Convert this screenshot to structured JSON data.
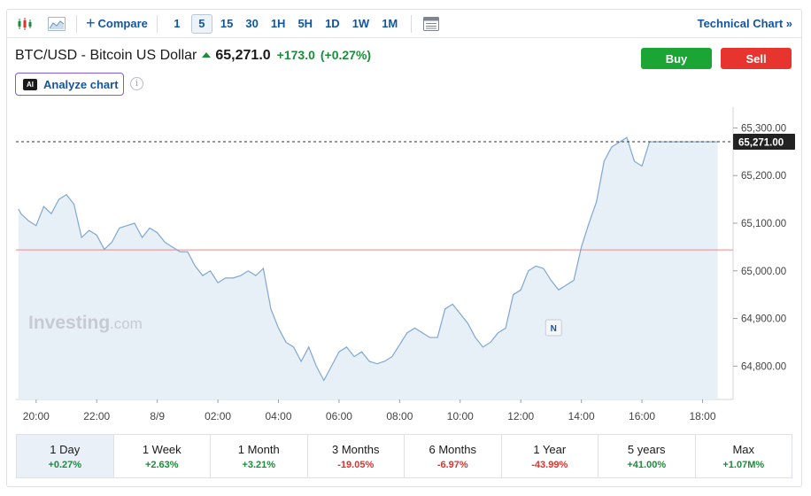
{
  "toolbar": {
    "icons": [
      "candlestick-icon",
      "area-chart-icon"
    ],
    "compare_label": "Compare",
    "intervals": [
      "1",
      "5",
      "15",
      "30",
      "1H",
      "5H",
      "1D",
      "1W",
      "1M"
    ],
    "active_interval": "5",
    "technical_chart_label": "Technical Chart »"
  },
  "header": {
    "symbol": "BTC/USD - Bitcoin US Dollar",
    "price": "65,271.0",
    "change": "+173.0",
    "change_pct": "(+0.27%)",
    "trend": "up"
  },
  "actions": {
    "buy_label": "Buy",
    "sell_label": "Sell"
  },
  "analyze_label": "Analyze chart",
  "info_glyph": "i",
  "ai_badge": "AI",
  "watermark": {
    "brand": "Investing",
    "suffix": ".com"
  },
  "colors": {
    "line": "#7fa7d0",
    "fill": "#e8f0f7",
    "up": "#1a8d3a",
    "down": "#e0312b",
    "ref_line": "#e88a8a"
  },
  "chart_data": {
    "type": "area",
    "title": "",
    "xlabel": "",
    "ylabel": "",
    "x_ticks": [
      "20:00",
      "22:00",
      "8/9",
      "02:00",
      "04:00",
      "06:00",
      "08:00",
      "10:00",
      "12:00",
      "14:00",
      "16:00",
      "18:00"
    ],
    "y_ticks": [
      "64,800.00",
      "64,900.00",
      "65,000.00",
      "65,100.00",
      "65,200.00",
      "65,300.00"
    ],
    "ylim": [
      64730,
      65325
    ],
    "reference_line": 65044,
    "current_price_label": "65,271.00",
    "current_price": 65271,
    "event_marker": {
      "label": "N",
      "time": "13:05"
    },
    "series": [
      {
        "x": [
          "19:25",
          "19:30",
          "19:45",
          "20:00",
          "20:15",
          "20:30",
          "20:45",
          "21:00",
          "21:15",
          "21:30",
          "21:45",
          "22:00",
          "22:15",
          "22:30",
          "22:45",
          "23:00",
          "23:15",
          "23:30",
          "23:45",
          "0:00",
          "0:15",
          "0:30",
          "0:45",
          "1:00",
          "1:15",
          "1:30",
          "1:45",
          "2:00",
          "2:15",
          "2:30",
          "2:45",
          "3:00",
          "3:15",
          "3:30",
          "3:45",
          "4:00",
          "4:15",
          "4:30",
          "4:45",
          "5:00",
          "5:15",
          "5:30",
          "5:45",
          "6:00",
          "6:15",
          "6:30",
          "6:45",
          "7:00",
          "7:15",
          "7:30",
          "7:45",
          "8:00",
          "8:15",
          "8:30",
          "8:45",
          "9:00",
          "9:15",
          "9:30",
          "9:45",
          "10:00",
          "10:15",
          "10:30",
          "10:45",
          "11:00",
          "11:15",
          "11:30",
          "11:45",
          "12:00",
          "12:15",
          "12:30",
          "12:45",
          "13:00",
          "13:15",
          "13:30",
          "13:45",
          "14:00",
          "14:15",
          "14:30",
          "14:45",
          "15:00",
          "15:15",
          "15:30",
          "15:45",
          "16:00",
          "16:15",
          "16:30",
          "16:45",
          "17:00",
          "17:15",
          "17:30",
          "17:45",
          "18:00",
          "18:15",
          "18:30"
        ],
        "y": [
          65130,
          65120,
          65105,
          65095,
          65135,
          65120,
          65150,
          65160,
          65140,
          65070,
          65085,
          65075,
          65045,
          65060,
          65090,
          65095,
          65100,
          65070,
          65090,
          65080,
          65060,
          65050,
          65040,
          65040,
          65010,
          64990,
          65000,
          64975,
          64985,
          64985,
          64990,
          65000,
          64990,
          65005,
          64920,
          64880,
          64850,
          64840,
          64810,
          64840,
          64800,
          64770,
          64800,
          64830,
          64840,
          64820,
          64830,
          64810,
          64805,
          64810,
          64820,
          64845,
          64870,
          64880,
          64870,
          64860,
          64860,
          64920,
          64930,
          64910,
          64890,
          64860,
          64840,
          64850,
          64870,
          64880,
          64950,
          64960,
          65000,
          65010,
          65005,
          64980,
          64960,
          64970,
          64980,
          65050,
          65100,
          65145,
          65230,
          65260,
          65270,
          65280,
          65230,
          65220,
          65271,
          65271,
          65271,
          65271,
          65271,
          65271,
          65271,
          65271,
          65271,
          65271
        ]
      }
    ]
  },
  "periods": [
    {
      "label": "1 Day",
      "value": "+0.27%",
      "dir": "pos",
      "active": true
    },
    {
      "label": "1 Week",
      "value": "+2.63%",
      "dir": "pos"
    },
    {
      "label": "1 Month",
      "value": "+3.21%",
      "dir": "pos"
    },
    {
      "label": "3 Months",
      "value": "-19.05%",
      "dir": "neg"
    },
    {
      "label": "6 Months",
      "value": "-6.97%",
      "dir": "neg"
    },
    {
      "label": "1 Year",
      "value": "-43.99%",
      "dir": "neg"
    },
    {
      "label": "5 years",
      "value": "+41.00%",
      "dir": "pos"
    },
    {
      "label": "Max",
      "value": "+1.07M%",
      "dir": "pos"
    }
  ]
}
